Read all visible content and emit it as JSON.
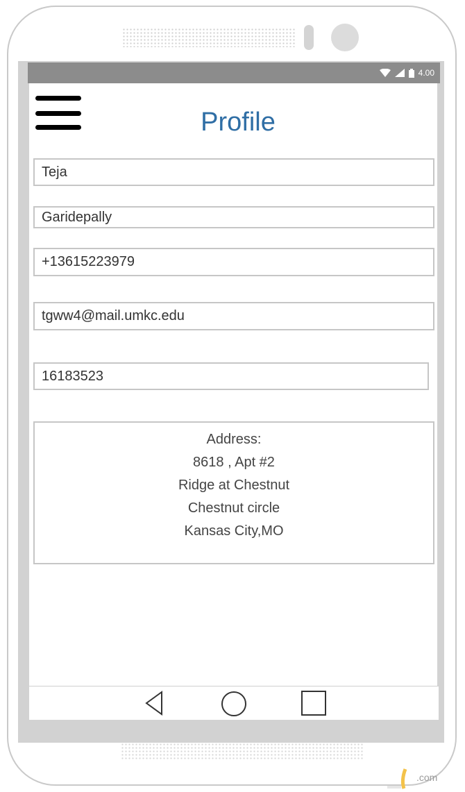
{
  "status_bar": {
    "time": "4.00"
  },
  "header": {
    "title": "Profile"
  },
  "fields": {
    "first_name": "Teja",
    "last_name": "Garidepally",
    "phone": "+13615223979",
    "email": "tgww4@mail.umkc.edu",
    "id_number": "16183523"
  },
  "address": {
    "lines": [
      "Address:",
      "8618 , Apt #2",
      "Ridge at Chestnut",
      "Chestnut circle",
      "Kansas City,MO"
    ]
  },
  "watermark": {
    "suffix": ".com"
  },
  "colors": {
    "title": "#2f6ea5",
    "status_bar": "#8c8c8c",
    "bezel": "#d2d2d2"
  }
}
